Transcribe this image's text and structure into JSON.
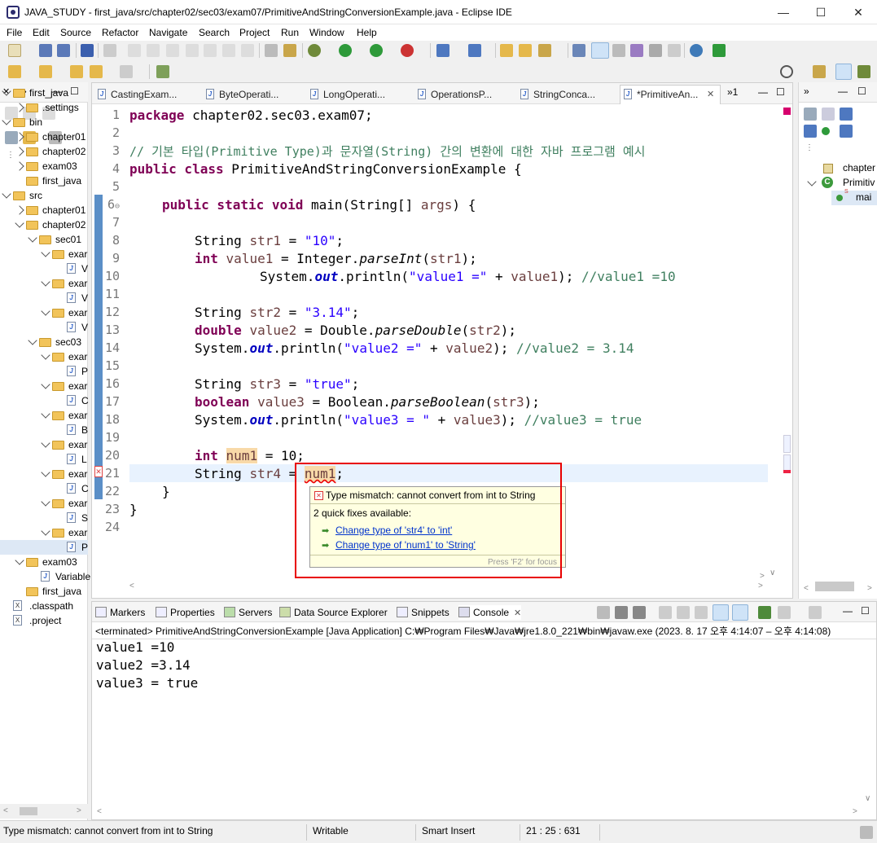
{
  "window": {
    "title": "JAVA_STUDY - first_java/src/chapter02/sec03/exam07/PrimitiveAndStringConversionExample.java - Eclipse IDE"
  },
  "menu": [
    "File",
    "Edit",
    "Source",
    "Refactor",
    "Navigate",
    "Search",
    "Project",
    "Run",
    "Window",
    "Help"
  ],
  "explorer": {
    "items": [
      {
        "label": "first_java"
      },
      {
        "label": ".settings"
      },
      {
        "label": "bin"
      },
      {
        "label": "chapter01"
      },
      {
        "label": "chapter02"
      },
      {
        "label": "exam03"
      },
      {
        "label": "first_java"
      },
      {
        "label": "src"
      },
      {
        "label": "chapter01"
      },
      {
        "label": "chapter02"
      },
      {
        "label": "sec01"
      },
      {
        "label": "exar"
      },
      {
        "label": "V"
      },
      {
        "label": "exar"
      },
      {
        "label": "V"
      },
      {
        "label": "exar"
      },
      {
        "label": "V"
      },
      {
        "label": "sec03"
      },
      {
        "label": "exar"
      },
      {
        "label": "P"
      },
      {
        "label": "exar"
      },
      {
        "label": "C"
      },
      {
        "label": "exar"
      },
      {
        "label": "B"
      },
      {
        "label": "exar"
      },
      {
        "label": "L"
      },
      {
        "label": "exar"
      },
      {
        "label": "C"
      },
      {
        "label": "exar"
      },
      {
        "label": "S"
      },
      {
        "label": "exar"
      },
      {
        "label": "P"
      },
      {
        "label": "exam03"
      },
      {
        "label": "Variable"
      },
      {
        "label": "first_java"
      },
      {
        "label": ".classpath"
      },
      {
        "label": ".project"
      }
    ]
  },
  "editor": {
    "tabs": [
      "CastingExam...",
      "ByteOperati...",
      "LongOperati...",
      "OperationsP...",
      "StringConca...",
      "*PrimitiveAn..."
    ],
    "overflow": "»1",
    "lines": {
      "l1_pkg": "package",
      "l1_rest": " chapter02.sec03.exam07;",
      "l3": "// 기본 타입(Primitive Type)과 문자열(String) 간의 변환에 대한 자바 프로그램 예시",
      "l4_kw": "public class",
      "l4_rest": " PrimitiveAndStringConversionExample {",
      "l6_kw": "public static void",
      "l6_rest": " main(String[] ",
      "l6_args": "args",
      "l6_end": ") {",
      "l8_a": "String ",
      "l8_v": "str1",
      "l8_b": " = ",
      "l8_s": "\"10\"",
      "l8_c": ";",
      "l9_kw": "int",
      "l9_a": " ",
      "l9_v": "value1",
      "l9_b": " = Integer.",
      "l9_m": "parseInt",
      "l9_c": "(",
      "l9_v2": "str1",
      "l9_d": ");",
      "l10_a": "System.",
      "l10_f": "out",
      "l10_b": ".println(",
      "l10_s": "\"value1 =\"",
      "l10_c": " + ",
      "l10_v": "value1",
      "l10_d": "); ",
      "l10_cm": "//value1 =10",
      "l12_a": "String ",
      "l12_v": "str2",
      "l12_b": " = ",
      "l12_s": "\"3.14\"",
      "l12_c": ";",
      "l13_kw": "double",
      "l13_a": " ",
      "l13_v": "value2",
      "l13_b": " = Double.",
      "l13_m": "parseDouble",
      "l13_c": "(",
      "l13_v2": "str2",
      "l13_d": ");",
      "l14_a": "System.",
      "l14_f": "out",
      "l14_b": ".println(",
      "l14_s": "\"value2 =\"",
      "l14_c": " + ",
      "l14_v": "value2",
      "l14_d": "); ",
      "l14_cm": "//value2 = 3.14",
      "l16_a": "String ",
      "l16_v": "str3",
      "l16_b": " = ",
      "l16_s": "\"true\"",
      "l16_c": ";",
      "l17_kw": "boolean",
      "l17_a": " ",
      "l17_v": "value3",
      "l17_b": " = Boolean.",
      "l17_m": "parseBoolean",
      "l17_c": "(",
      "l17_v2": "str3",
      "l17_d": ");",
      "l18_a": "System.",
      "l18_f": "out",
      "l18_b": ".println(",
      "l18_s": "\"value3 = \"",
      "l18_c": " + ",
      "l18_v": "value3",
      "l18_d": "); ",
      "l18_cm": "//value3 = true",
      "l20_kw": "int",
      "l20_a": " ",
      "l20_v": "num1",
      "l20_b": " = 10;",
      "l21_a": "String ",
      "l21_v": "str4",
      "l21_b": " = ",
      "l21_v2": "num1",
      "l21_c": ";",
      "l22": "}",
      "l23": "}"
    }
  },
  "hover": {
    "error": "Type mismatch: cannot convert from int to String",
    "count": "2 quick fixes available:",
    "fix1": "Change type of 'str4' to 'int'",
    "fix2": "Change type of 'num1' to 'String'",
    "focus": "Press 'F2' for focus"
  },
  "outline": {
    "items": [
      "chapter",
      "Primitiv",
      "mai"
    ]
  },
  "console": {
    "tabs": [
      "Markers",
      "Properties",
      "Servers",
      "Data Source Explorer",
      "Snippets",
      "Console"
    ],
    "header": "<terminated> PrimitiveAndStringConversionExample [Java Application] C:₩Program Files₩Java₩jre1.8.0_221₩bin₩javaw.exe  (2023. 8. 17 오후 4:14:07 – 오후 4:14:08)",
    "output": [
      "value1 =10",
      "value2 =3.14",
      "value3 = true"
    ]
  },
  "status": {
    "message": "Type mismatch: cannot convert from int to String",
    "mode": "Writable",
    "insert": "Smart Insert",
    "position": "21 : 25 : 631"
  },
  "colors": {
    "keyword": "#7f0055",
    "string": "#2a00ff",
    "comment": "#3f7f5f",
    "error_box": "#e80000"
  }
}
